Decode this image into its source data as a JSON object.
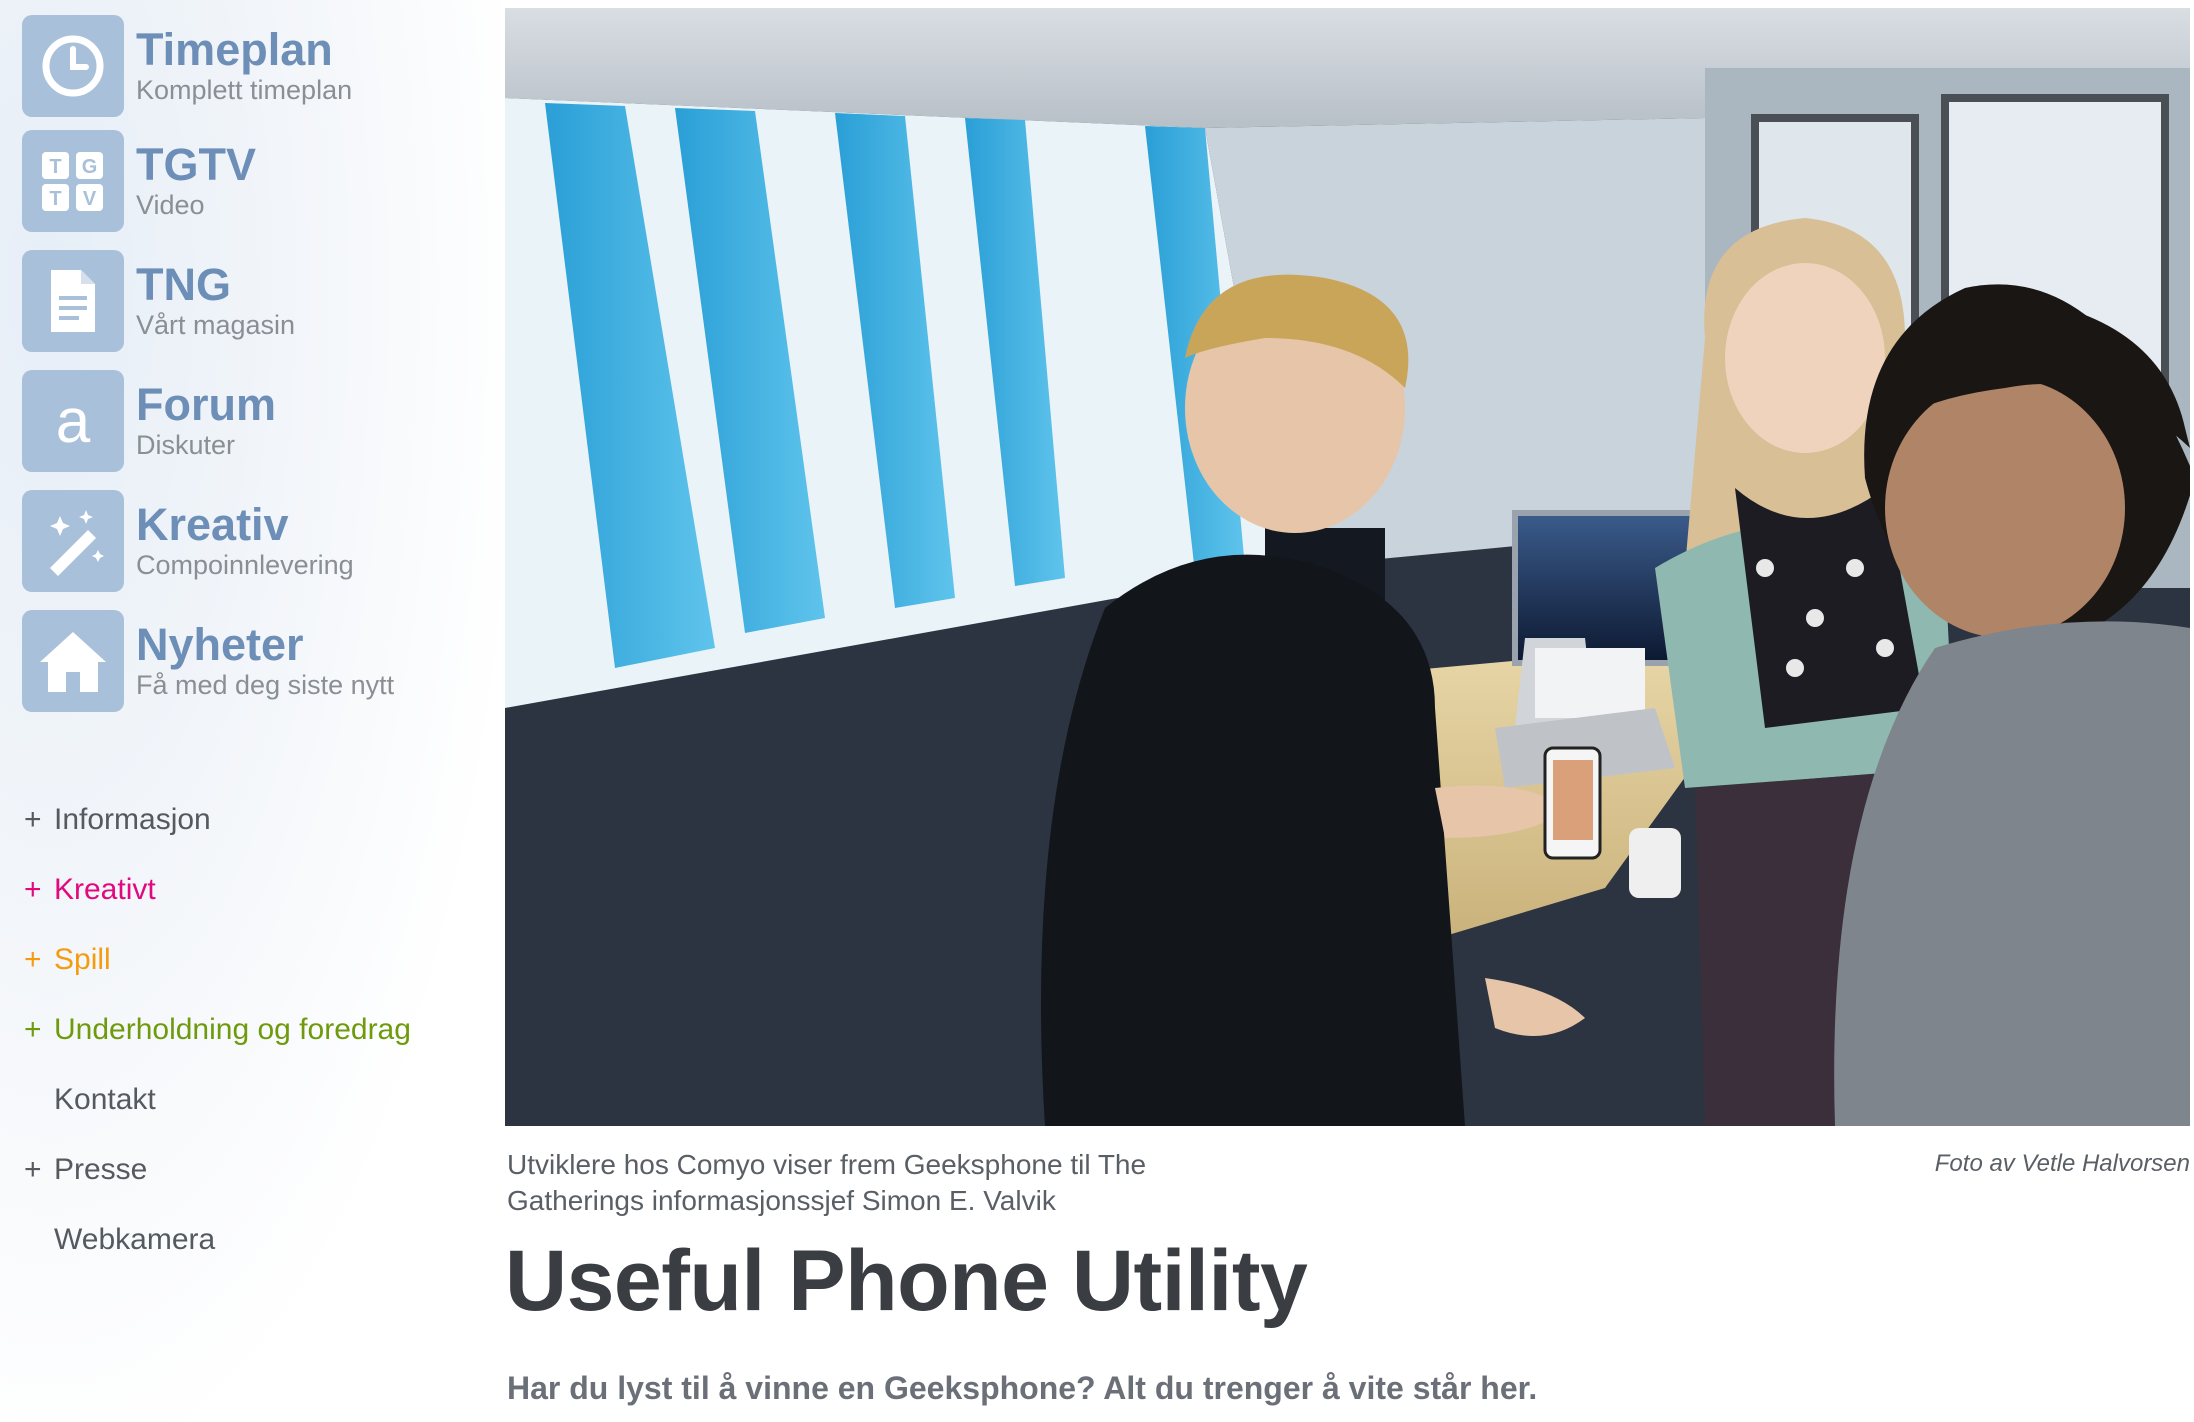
{
  "quick_links": [
    {
      "title": "Timeplan",
      "subtitle": "Komplett timeplan",
      "icon": "clock-icon"
    },
    {
      "title": "TGTV",
      "subtitle": "Video",
      "icon": "tgtv-icon"
    },
    {
      "title": "TNG",
      "subtitle": "Vårt magasin",
      "icon": "document-icon"
    },
    {
      "title": "Forum",
      "subtitle": "Diskuter",
      "icon": "forum-a-icon"
    },
    {
      "title": "Kreativ",
      "subtitle": "Compoinnlevering",
      "icon": "magic-wand-icon"
    },
    {
      "title": "Nyheter",
      "subtitle": "Få med deg siste nytt",
      "icon": "home-icon"
    }
  ],
  "menu": [
    {
      "label": "Informasjon",
      "plus": "+",
      "color": "#555a60"
    },
    {
      "label": "Kreativt",
      "plus": "+",
      "color": "#e2087e"
    },
    {
      "label": "Spill",
      "plus": "+",
      "color": "#f39c12"
    },
    {
      "label": "Underholdning og foredrag",
      "plus": "+",
      "color": "#6e9a0c"
    },
    {
      "label": "Kontakt",
      "plus": "",
      "color": "#555a60"
    },
    {
      "label": "Presse",
      "plus": "+",
      "color": "#555a60"
    },
    {
      "label": "Webkamera",
      "plus": "",
      "color": "#555a60"
    }
  ],
  "article": {
    "caption": "Utviklere hos Comyo viser frem Geeksphone til The Gatherings informasjonssjef Simon E. Valvik",
    "credit": "Foto av Vetle Halvorsen",
    "title": "Useful Phone Utility",
    "lead": "Har du lyst til å vinne en Geeksphone? Alt du trenger å vite står her."
  }
}
